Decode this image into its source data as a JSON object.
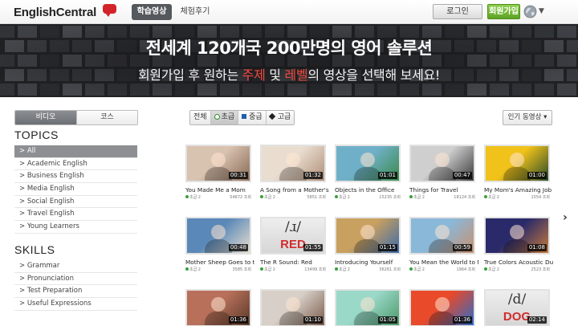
{
  "header": {
    "logo_text": "EnglishCentral",
    "nav": [
      {
        "label": "학습영상",
        "active": true
      },
      {
        "label": "체험후기",
        "active": false
      }
    ],
    "login_label": "로그인",
    "signup_label": "회원가입",
    "language_icon": "globe-icon"
  },
  "hero": {
    "title": "전세계 120개국 200만명의 영어 솔루션",
    "subtitle_parts": [
      "회원가입 후 원하는 ",
      "주제",
      " 및 ",
      "레벨",
      "의 영상을 선택해 보세요!"
    ]
  },
  "sidebar": {
    "toggle": [
      {
        "label": "비디오",
        "active": true
      },
      {
        "label": "코스",
        "active": false
      }
    ],
    "topics_heading": "TOPICS",
    "topics": [
      {
        "label": "> All",
        "active": true
      },
      {
        "label": "> Academic English",
        "active": false
      },
      {
        "label": "> Business English",
        "active": false
      },
      {
        "label": "> Media English",
        "active": false
      },
      {
        "label": "> Social English",
        "active": false
      },
      {
        "label": "> Travel English",
        "active": false
      },
      {
        "label": "> Young Learners",
        "active": false
      }
    ],
    "skills_heading": "SKILLS",
    "skills": [
      {
        "label": "> Grammar"
      },
      {
        "label": "> Pronunciation"
      },
      {
        "label": "> Test Preparation"
      },
      {
        "label": "> Useful Expressions"
      }
    ]
  },
  "filters": {
    "levels": [
      {
        "label": "전체",
        "marker": "",
        "selected": false
      },
      {
        "label": "초급",
        "marker": "green-circle",
        "selected": true
      },
      {
        "label": "중급",
        "marker": "blue-square",
        "selected": false
      },
      {
        "label": "고급",
        "marker": "black-diamond",
        "selected": false
      }
    ],
    "sort_label": "인기 동영상 ▾"
  },
  "videos": [
    {
      "title": "You Made Me a Mom",
      "duration": "00:31",
      "level": "초급 2",
      "views": "54672 조회",
      "thumb_colors": [
        "#d8c2b0",
        "#8a6b55"
      ]
    },
    {
      "title": "A Song from a Mother's...",
      "duration": "01:32",
      "level": "초급 2",
      "views": "5851 조회",
      "thumb_colors": [
        "#e9ddd0",
        "#b08f78"
      ]
    },
    {
      "title": "Objects in the Office",
      "duration": "01:01",
      "level": "초급 2",
      "views": "15235 조회",
      "thumb_colors": [
        "#6fb0c8",
        "#3a8a4a"
      ]
    },
    {
      "title": "Things for Travel",
      "duration": "00:47",
      "level": "초급 2",
      "views": "18124 조회",
      "thumb_colors": [
        "#cfcfcf",
        "#3a3a3a"
      ]
    },
    {
      "title": "My Mom's Amazing Job",
      "duration": "01:00",
      "level": "초급 2",
      "views": "1554 조회",
      "thumb_colors": [
        "#f0c21a",
        "#2a4a2a"
      ]
    },
    {
      "title": "Mother Sheep Goes to th...",
      "duration": "00:48",
      "level": "초급 2",
      "views": "3585 조회",
      "thumb_colors": [
        "#5a88b8",
        "#e8e0d0"
      ]
    },
    {
      "title": "The R Sound: Red",
      "duration": "01:55",
      "level": "초급 2",
      "views": "13499 조회",
      "thumb_colors": [
        "#bfbfbf",
        "#d83030"
      ]
    },
    {
      "title": "Introducing Yourself",
      "duration": "01:15",
      "level": "초급 2",
      "views": "36261 조회",
      "thumb_colors": [
        "#c8a060",
        "#3a6aa8"
      ]
    },
    {
      "title": "You Mean the World to Me",
      "duration": "00:59",
      "level": "초급 2",
      "views": "1964 조회",
      "thumb_colors": [
        "#8ab8d8",
        "#c89070"
      ]
    },
    {
      "title": "True Colors Acoustic Duet",
      "duration": "01:08",
      "level": "초급 2",
      "views": "2523 조회",
      "thumb_colors": [
        "#2a2a6a",
        "#c87a3a"
      ]
    },
    {
      "title": "",
      "duration": "01:36",
      "level": "",
      "views": "",
      "thumb_colors": [
        "#b8705a",
        "#5a3a2a"
      ]
    },
    {
      "title": "",
      "duration": "01:10",
      "level": "",
      "views": "",
      "thumb_colors": [
        "#d8d0c8",
        "#7a5a4a"
      ]
    },
    {
      "title": "",
      "duration": "01:05",
      "level": "",
      "views": "",
      "thumb_colors": [
        "#9ad8c8",
        "#4a9a6a"
      ]
    },
    {
      "title": "",
      "duration": "01:36",
      "level": "",
      "views": "",
      "thumb_colors": [
        "#e84a2a",
        "#2a6ac8"
      ]
    },
    {
      "title": "",
      "duration": "02:14",
      "level": "",
      "views": "",
      "thumb_colors": [
        "#e8e8e8",
        "#c83a3a"
      ]
    }
  ],
  "thumb_text": {
    "red_phonetic": "/ɹ/",
    "red_word": "RED",
    "dog_phonetic": "/d/",
    "dog_word": "DOG"
  },
  "next_arrow": "›"
}
